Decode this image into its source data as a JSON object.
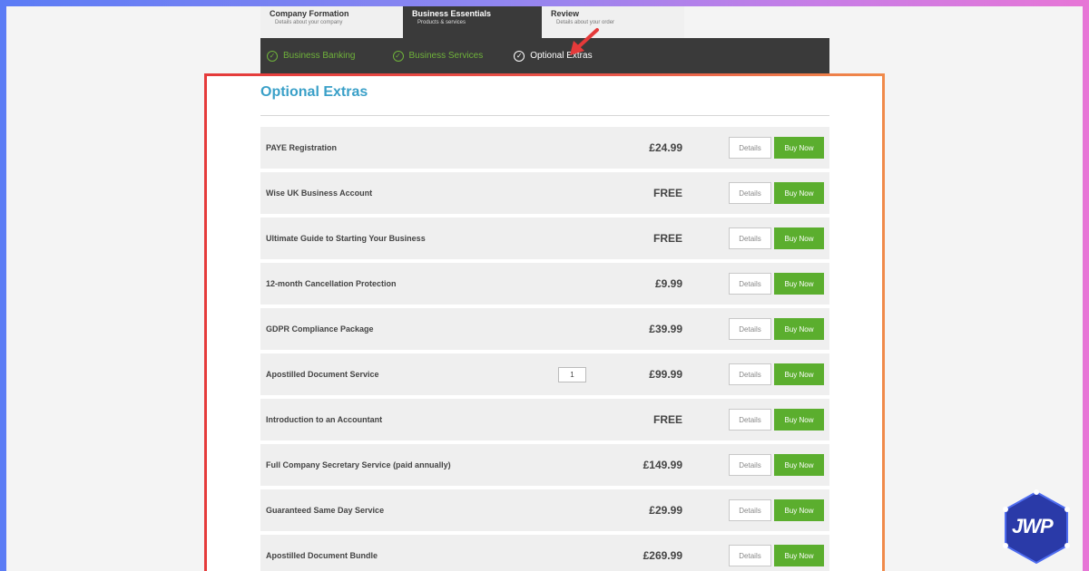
{
  "steps": [
    {
      "title": "Company Formation",
      "subtitle": "Details about your company"
    },
    {
      "title": "Business Essentials",
      "subtitle": "Products & services"
    },
    {
      "title": "Review",
      "subtitle": "Details about your order"
    }
  ],
  "substeps": [
    {
      "label": "Business Banking"
    },
    {
      "label": "Business Services"
    },
    {
      "label": "Optional Extras"
    }
  ],
  "heading": "Optional Extras",
  "buttons": {
    "details": "Details",
    "buy": "Buy Now"
  },
  "items": [
    {
      "name": "PAYE Registration",
      "price": "£24.99"
    },
    {
      "name": "Wise UK Business Account",
      "price": "FREE"
    },
    {
      "name": "Ultimate Guide to Starting Your Business",
      "price": "FREE"
    },
    {
      "name": "12-month Cancellation Protection",
      "price": "£9.99"
    },
    {
      "name": "GDPR Compliance Package",
      "price": "£39.99"
    },
    {
      "name": "Apostilled Document Service",
      "price": "£99.99",
      "qty": "1"
    },
    {
      "name": "Introduction to an Accountant",
      "price": "FREE"
    },
    {
      "name": "Full Company Secretary Service (paid annually)",
      "price": "£149.99"
    },
    {
      "name": "Guaranteed Same Day Service",
      "price": "£29.99"
    },
    {
      "name": "Apostilled Document Bundle",
      "price": "£269.99"
    }
  ],
  "logo": {
    "text": "JWP"
  },
  "colors": {
    "accent_blue": "#3aa0c8",
    "buy_green": "#5bae2e",
    "highlight_red": "#e53a3a"
  }
}
